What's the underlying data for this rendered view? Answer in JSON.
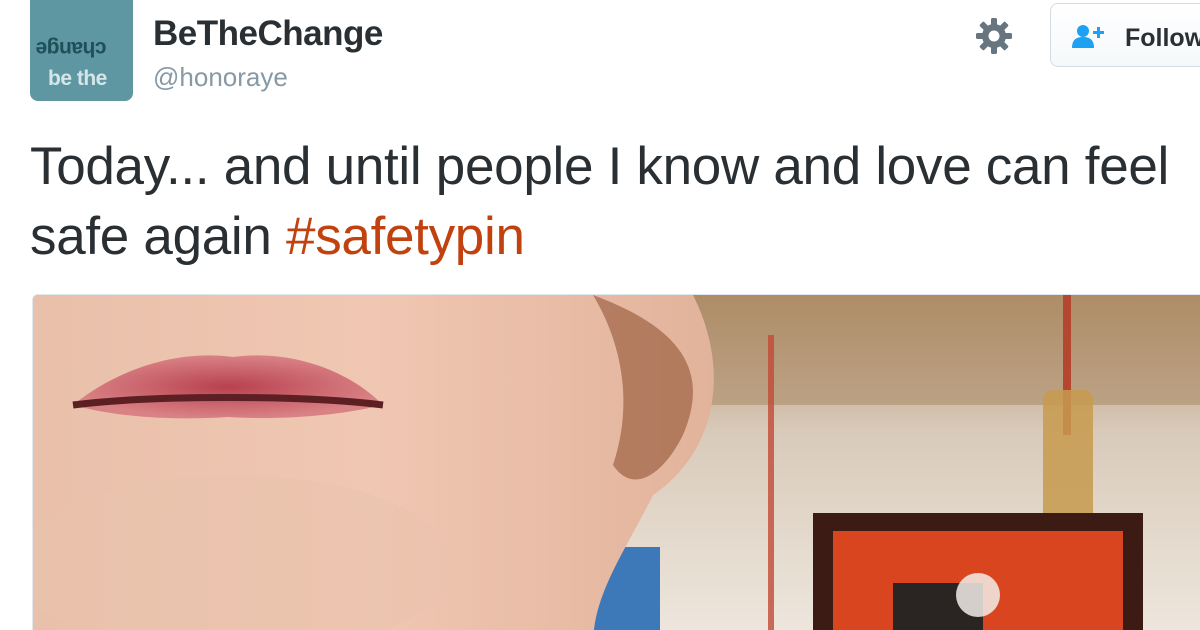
{
  "user": {
    "display_name": "BeTheChange",
    "handle": "@honoraye",
    "avatar": {
      "top_text_inverted": "change",
      "bottom_text": "be the",
      "color": "#5e97a1"
    }
  },
  "actions": {
    "settings_icon": "gear-icon",
    "follow_label": "Follow",
    "follow_icon": "add-user-icon"
  },
  "tweet": {
    "text": "Today... and until people I know and love can feel safe again ",
    "hashtag": "#safetypin",
    "hashtag_color": "#c1410f"
  },
  "media": {
    "type": "photo"
  }
}
